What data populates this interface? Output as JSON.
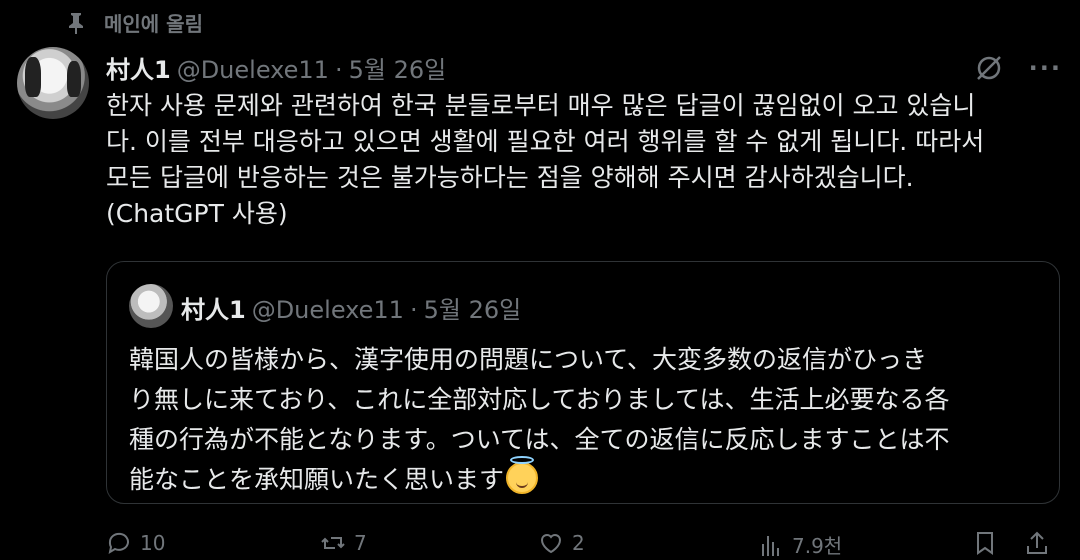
{
  "pinned": {
    "label": "메인에 올림"
  },
  "tweet": {
    "author_name": "村人1",
    "handle": "@Duelexe11",
    "separator": "·",
    "date": "5월 26일",
    "text": "한자 사용 문제와 관련하여 한국 분들로부터 매우 많은 답글이 끊임없이 오고 있습니\n다. 이를 전부 대응하고 있으면 생활에 필요한 여러 행위를 할 수 없게 됩니다. 따라서\n모든 답글에 반응하는 것은 불가능하다는 점을 양해해 주시면 감사하겠습니다.\n(ChatGPT 사용)"
  },
  "quote": {
    "author_name": "村人1",
    "handle": "@Duelexe11",
    "separator": "·",
    "date": "5월 26일",
    "text": "韓国人の皆様から、漢字使用の問題について、大変多数の返信がひっき\nり無しに来ており、これに全部対応しておりましては、生活上必要なる各\n種の行為が不能となります。ついては、全ての返信に反応しますことは不\n能なことを承知願いたく思います",
    "emoji": "smiling-face-with-halo-icon"
  },
  "actions": {
    "replies": "10",
    "reposts": "7",
    "likes": "2",
    "views": "7.9천"
  },
  "colors": {
    "background": "#000000",
    "text": "#e7e9ea",
    "muted": "#71767b",
    "border": "#2f3336"
  }
}
